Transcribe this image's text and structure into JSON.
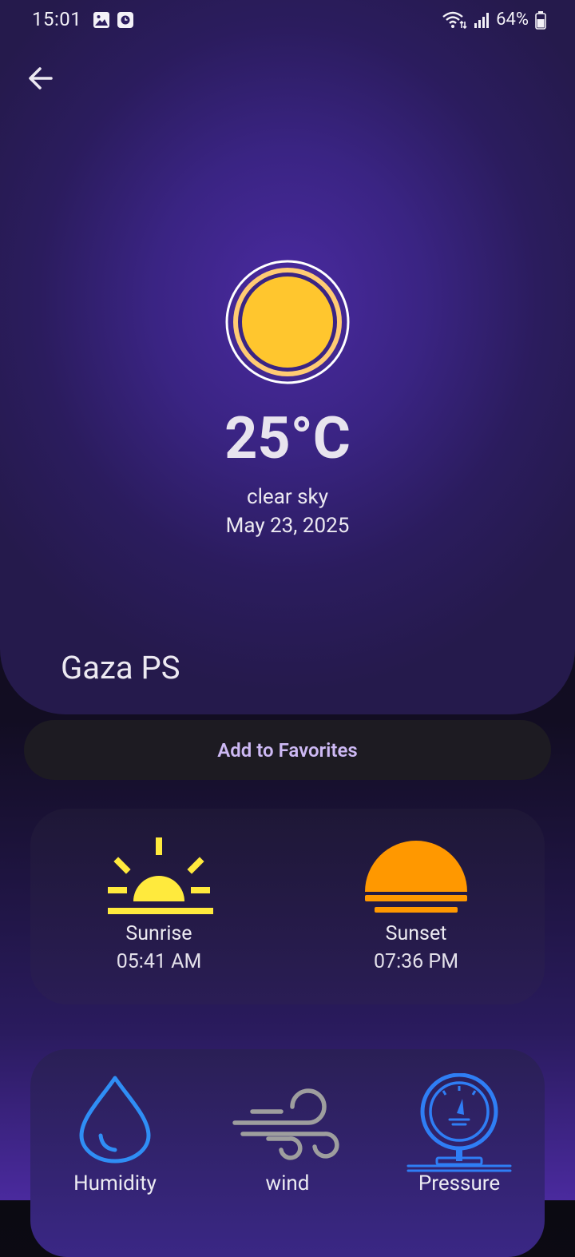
{
  "status_bar": {
    "time": "15:01",
    "battery": "64%",
    "icons": [
      "image-icon",
      "clock-app-icon",
      "wifi-icon",
      "signal-icon",
      "battery-icon"
    ]
  },
  "header": {
    "back_icon": "arrow-left-icon"
  },
  "weather": {
    "icon": "sun-icon",
    "temperature": "25°C",
    "description": "clear sky",
    "date": "May 23, 2025",
    "city": "Gaza PS"
  },
  "actions": {
    "add_favorites_label": "Add to Favorites"
  },
  "sun_times": {
    "sunrise": {
      "label": "Sunrise",
      "time": "05:41 AM",
      "icon": "sunrise-icon"
    },
    "sunset": {
      "label": "Sunset",
      "time": "07:36 PM",
      "icon": "sunset-icon"
    }
  },
  "stats": [
    {
      "label": "Humidity",
      "icon": "water-drop-icon"
    },
    {
      "label": "wind",
      "icon": "wind-icon"
    },
    {
      "label": "Pressure",
      "icon": "pressure-gauge-icon"
    }
  ],
  "colors": {
    "hero_purple": "#3a2483",
    "sun_yellow": "#ffc62e",
    "sunrise_yellow": "#ffea3d",
    "sunset_orange": "#ff9800",
    "button_text": "#cdb9f4",
    "humidity_blue": "#2f8ef5",
    "wind_gray": "#9e9e9e",
    "pressure_blue": "#2f7ef5"
  }
}
